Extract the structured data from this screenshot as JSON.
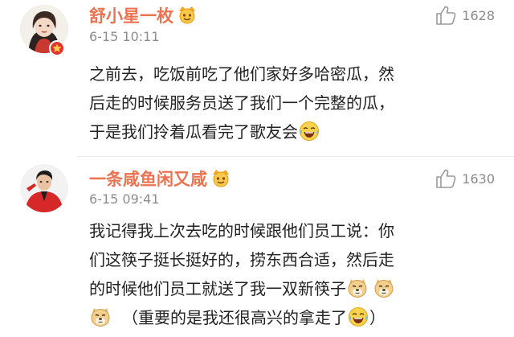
{
  "comments": [
    {
      "username": "舒小星一枚",
      "timestamp": "6-15 10:11",
      "likes": "1628",
      "avatar_icon": "avatar-woman-photo",
      "badge_icon": "vip-badge-icon",
      "member_icon": "crown-face-icon",
      "lines": [
        "之前去，吃饭前吃了他们家好多哈密瓜，然",
        "后走的时候服务员送了我们一个完整的瓜，",
        "于是我们拎着瓜看完了歌友会"
      ],
      "line_emojis": [
        "",
        "",
        "laughing-tears-emoji"
      ]
    },
    {
      "username": "一条咸鱼闲又咸",
      "timestamp": "6-15 09:41",
      "likes": "1630",
      "avatar_icon": "avatar-man-red-suit",
      "member_icon": "crown-face-icon",
      "lines": [
        "我记得我上次去吃的时候跟他们员工说：你",
        "们这筷子挺长挺好的，捞东西合适，然后走",
        "的时候他们员工就送了我一双新筷子",
        "（重要的是我还很高兴的拿走了"
      ],
      "line4_suffix": "）",
      "line_emojis": [
        "",
        "",
        "doge-emoji doge-emoji",
        "doge-emoji | laughing-tears-emoji"
      ]
    }
  ],
  "colors": {
    "username": "#eb7350",
    "meta": "#8c8c8c",
    "text": "#222222",
    "badge": "#e0362d"
  }
}
